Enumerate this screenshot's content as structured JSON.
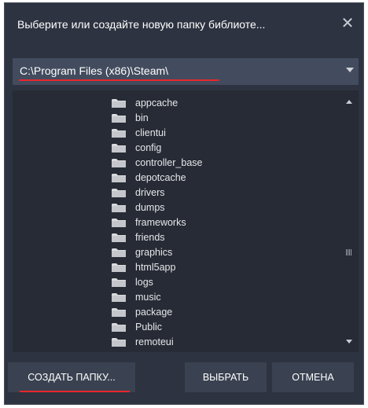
{
  "dialog": {
    "title": "Выберите или создайте новую папку библиоте...",
    "close_glyph": "✕"
  },
  "path_select": {
    "value": "C:\\Program Files (x86)\\Steam\\"
  },
  "folders": [
    "appcache",
    "bin",
    "clientui",
    "config",
    "controller_base",
    "depotcache",
    "drivers",
    "dumps",
    "frameworks",
    "friends",
    "graphics",
    "html5app",
    "logs",
    "music",
    "package",
    "Public",
    "remoteui"
  ],
  "buttons": {
    "create_folder": "СОЗДАТЬ ПАПКУ...",
    "select": "ВЫБРАТЬ",
    "cancel": "ОТМЕНА"
  },
  "icons": {
    "close": "close-icon",
    "dropdown": "chevron-down-icon",
    "folder": "folder-icon",
    "scroll_up": "scroll-up-icon",
    "scroll_down": "scroll-down-icon"
  },
  "colors": {
    "dialog_bg": "#2d3340",
    "field_bg": "#424c5e",
    "tree_bg": "#262b35",
    "button_bg": "#3a4251",
    "annotation_red": "#e8262b",
    "folder_icon": "#d9dadd"
  }
}
